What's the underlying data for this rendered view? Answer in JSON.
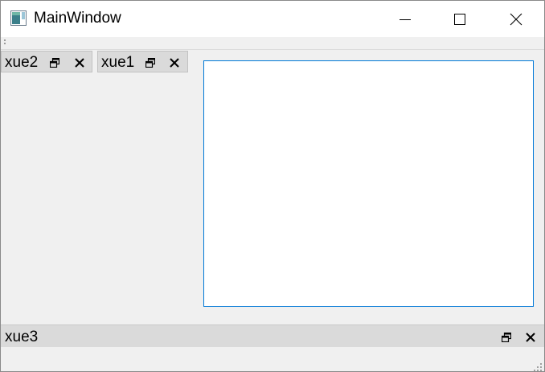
{
  "window": {
    "title": "MainWindow",
    "icon": "app-window-icon",
    "controls": [
      "minimize-icon",
      "maximize-icon",
      "close-icon"
    ]
  },
  "docks": {
    "tabs": [
      {
        "label": "xue2",
        "icons": [
          "float-icon",
          "close-icon"
        ]
      },
      {
        "label": "xue1",
        "icons": [
          "float-icon",
          "close-icon"
        ]
      }
    ],
    "bottom": {
      "label": "xue3",
      "icons": [
        "float-icon",
        "close-icon"
      ]
    }
  },
  "colors": {
    "focus_border": "#0078d7",
    "background": "#f0f0f0",
    "dock_title": "#dadada"
  }
}
